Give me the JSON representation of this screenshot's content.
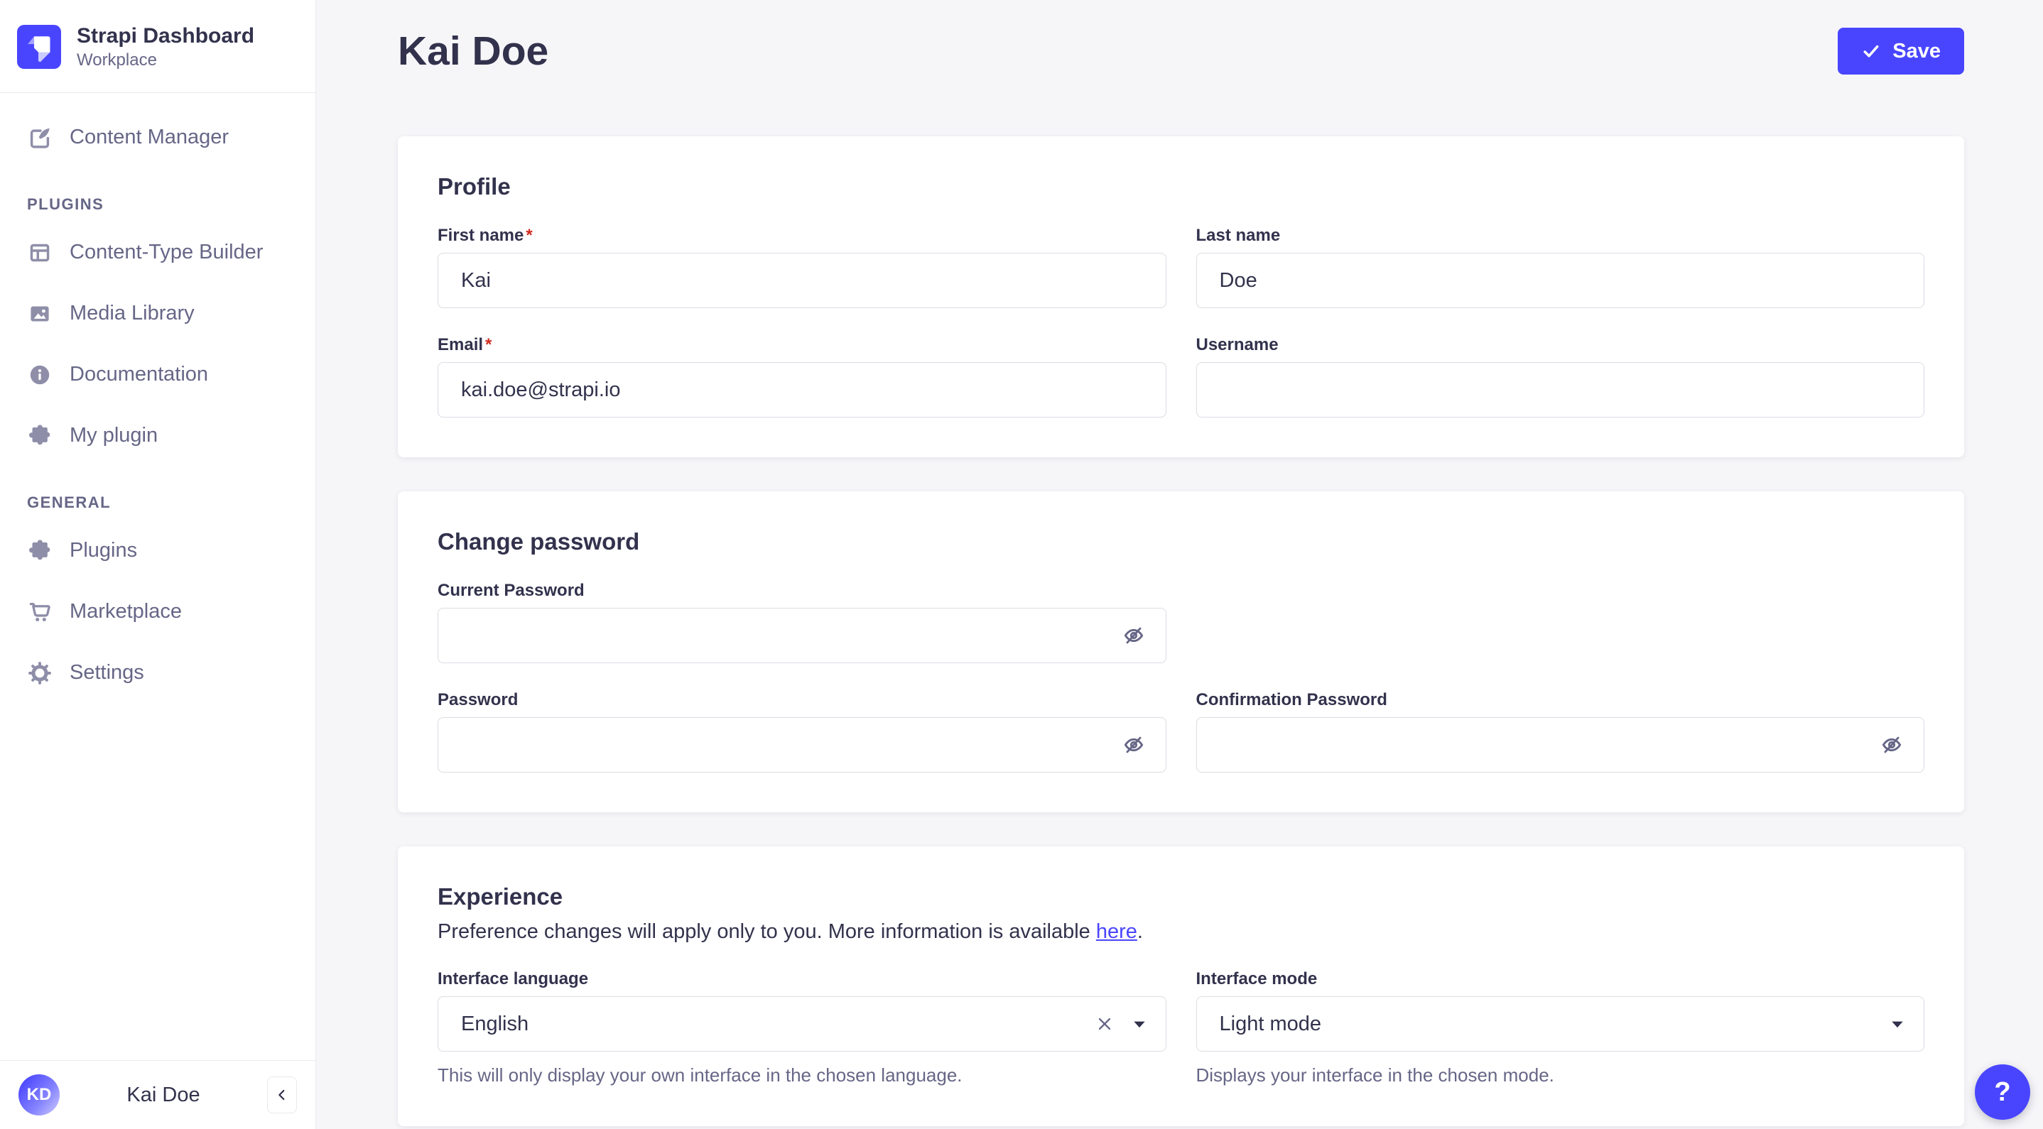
{
  "app": {
    "title": "Strapi Dashboard",
    "subtitle": "Workplace"
  },
  "sidebar": {
    "main_items": [
      {
        "label": "Content Manager",
        "icon": "edit-icon"
      }
    ],
    "sections": [
      {
        "label": "PLUGINS",
        "items": [
          {
            "label": "Content-Type Builder",
            "icon": "layout-icon"
          },
          {
            "label": "Media Library",
            "icon": "image-icon"
          },
          {
            "label": "Documentation",
            "icon": "info-icon"
          },
          {
            "label": "My plugin",
            "icon": "puzzle-icon"
          }
        ]
      },
      {
        "label": "GENERAL",
        "items": [
          {
            "label": "Plugins",
            "icon": "puzzle-icon"
          },
          {
            "label": "Marketplace",
            "icon": "cart-icon"
          },
          {
            "label": "Settings",
            "icon": "gear-icon"
          }
        ]
      }
    ],
    "user": {
      "initials": "KD",
      "name": "Kai Doe"
    }
  },
  "header": {
    "title": "Kai Doe",
    "save_button": {
      "label": "Save",
      "icon": "check-icon"
    }
  },
  "ui": {
    "required_mark": "*",
    "help_button": "?"
  },
  "profile": {
    "title": "Profile",
    "first_name": {
      "label": "First name",
      "required": true,
      "value": "Kai"
    },
    "last_name": {
      "label": "Last name",
      "required": false,
      "value": "Doe"
    },
    "email": {
      "label": "Email",
      "required": true,
      "value": "kai.doe@strapi.io"
    },
    "username": {
      "label": "Username",
      "required": false,
      "value": ""
    }
  },
  "change_password": {
    "title": "Change password",
    "current_password": {
      "label": "Current Password",
      "value": ""
    },
    "password": {
      "label": "Password",
      "value": ""
    },
    "confirmation_password": {
      "label": "Confirmation Password",
      "value": ""
    }
  },
  "experience": {
    "title": "Experience",
    "description_prefix": "Preference changes will apply only to you. More information is available ",
    "link_text": "here",
    "description_suffix": ".",
    "interface_language": {
      "label": "Interface language",
      "value": "English",
      "hint": "This will only display your own interface in the chosen language."
    },
    "interface_mode": {
      "label": "Interface mode",
      "value": "Light mode",
      "hint": "Displays your interface in the chosen mode."
    }
  },
  "colors": {
    "primary": "#4945ff",
    "background": "#f6f6f9",
    "text_dark": "#32324d",
    "text_muted": "#666687",
    "icon_gray": "#8e8ea9",
    "input_border": "#dcdce4",
    "divider": "#eaeaef",
    "required": "#d02b20",
    "link": "#4945ff"
  }
}
